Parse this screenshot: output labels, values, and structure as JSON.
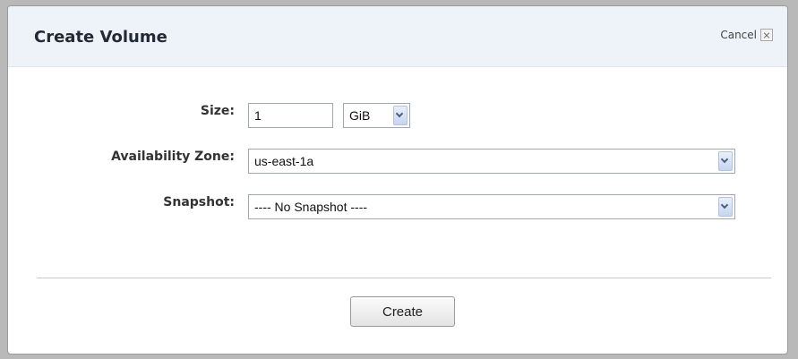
{
  "dialog": {
    "title": "Create Volume",
    "cancel_label": "Cancel"
  },
  "form": {
    "size": {
      "label": "Size:",
      "value": "1",
      "unit": "GiB"
    },
    "availability_zone": {
      "label": "Availability Zone:",
      "value": "us-east-1a"
    },
    "snapshot": {
      "label": "Snapshot:",
      "value": "---- No Snapshot ----"
    }
  },
  "actions": {
    "create_label": "Create"
  }
}
